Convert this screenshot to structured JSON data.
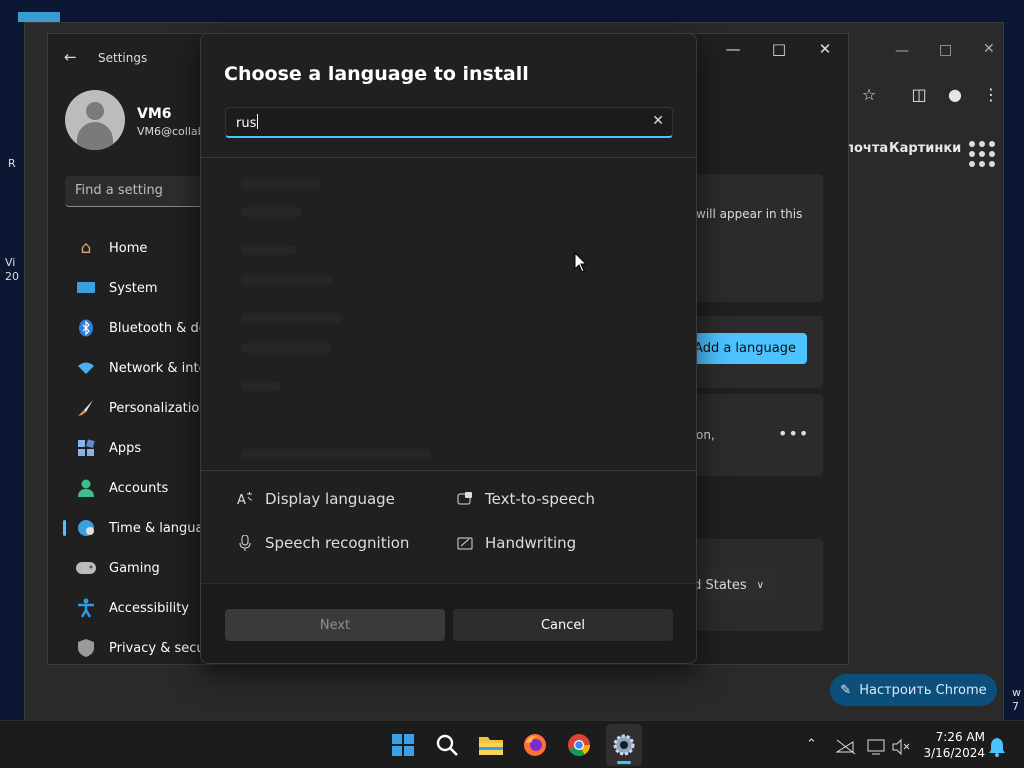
{
  "desktop": {
    "fragments": [
      "R",
      "Vi",
      "20",
      "w",
      "7"
    ]
  },
  "chrome": {
    "top_links": [
      "почта",
      "Картинки"
    ],
    "customize_label": "Настроить Chrome"
  },
  "settings": {
    "title": "Settings",
    "user_name": "VM6",
    "user_email": "VM6@collab",
    "find_placeholder": "Find a setting",
    "nav": [
      {
        "label": "Home",
        "icon": "home-icon",
        "color": "#d7a86e"
      },
      {
        "label": "System",
        "icon": "monitor-icon",
        "color": "#3aa0e0"
      },
      {
        "label": "Bluetooth & de",
        "icon": "bluetooth-icon",
        "color": "#2f7fd6"
      },
      {
        "label": "Network & inte",
        "icon": "wifi-icon",
        "color": "#48b0f0"
      },
      {
        "label": "Personalization",
        "icon": "brush-icon",
        "color": "#e0904a"
      },
      {
        "label": "Apps",
        "icon": "apps-icon",
        "color": "#8ab4e8"
      },
      {
        "label": "Accounts",
        "icon": "person-icon",
        "color": "#3cbf8a"
      },
      {
        "label": "Time & langua",
        "icon": "globe-icon",
        "color": "#3aa0e0"
      },
      {
        "label": "Gaming",
        "icon": "gamepad-icon",
        "color": "#bbbbbb"
      },
      {
        "label": "Accessibility",
        "icon": "accessibility-icon",
        "color": "#2f9ae8"
      },
      {
        "label": "Privacy & secu",
        "icon": "shield-icon",
        "color": "#9a9a9a"
      }
    ],
    "card_text_1": "will appear in this",
    "add_language_label": "Add a language",
    "card_text_2": "on,",
    "region_value": "d States"
  },
  "dialog": {
    "title": "Choose a language to install",
    "search_value": "rus",
    "features": [
      {
        "label": "Display language",
        "icon": "display-language-icon"
      },
      {
        "label": "Text-to-speech",
        "icon": "text-to-speech-icon"
      },
      {
        "label": "Speech recognition",
        "icon": "microphone-icon"
      },
      {
        "label": "Handwriting",
        "icon": "handwriting-icon"
      }
    ],
    "next_label": "Next",
    "cancel_label": "Cancel"
  },
  "taskbar": {
    "time": "7:26 AM",
    "date": "3/16/2024"
  },
  "colors": {
    "accent": "#4cc2ff",
    "chrome_button": "#0b4f7a"
  }
}
